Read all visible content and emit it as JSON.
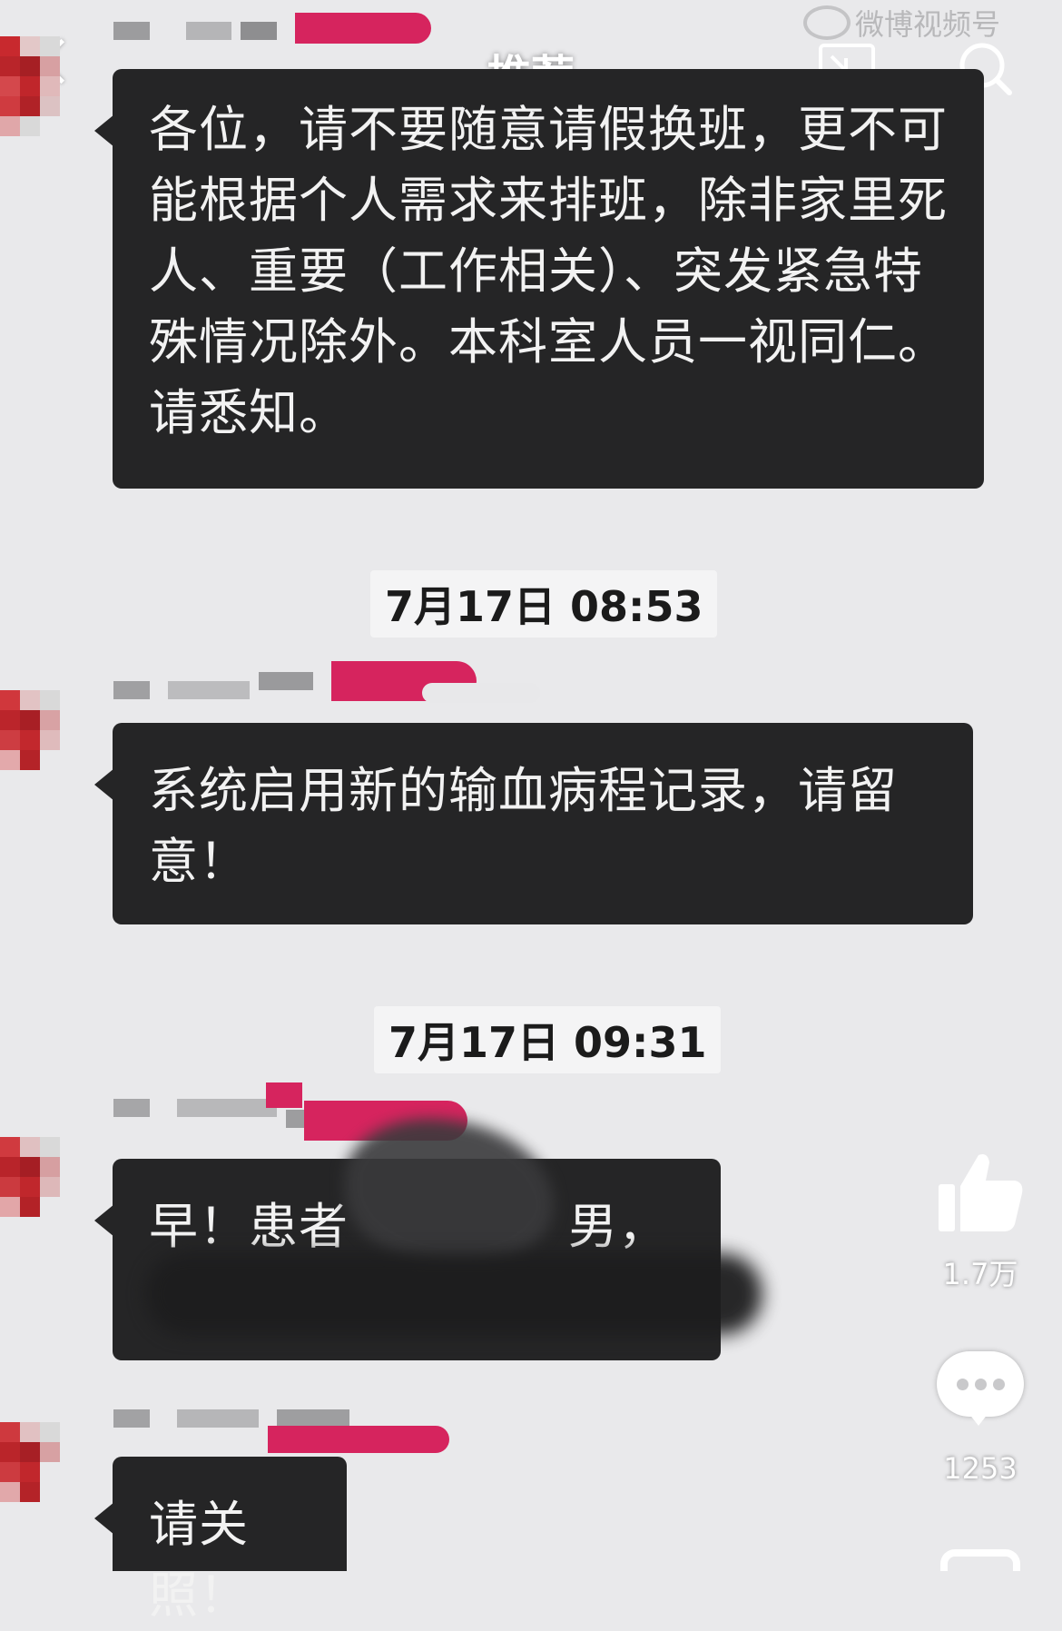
{
  "header": {
    "title": "推荐",
    "back_icon": "chevron-left-icon",
    "cast_icon": "screen-cast-icon",
    "search_icon": "search-icon",
    "watermark": "微博视频号"
  },
  "messages": [
    {
      "text": "各位，请不要随意请假换班，更不可能根据个人需求来排班，除非家里死人、重要（工作相关）、突发紧急特殊情况除外。本科室人员一视同仁。请悉知。"
    },
    {
      "text": "系统启用新的输血病程记录，请留意！"
    },
    {
      "text": "早！患者",
      "text_tail": "男，"
    },
    {
      "text": "请关照！"
    }
  ],
  "timestamps": [
    "7月17日 08:53",
    "7月17日 09:31"
  ],
  "actions": {
    "like_count": "1.7万",
    "comment_count": "1253"
  },
  "colors": {
    "background": "#e9e9eb",
    "bubble": "#252526",
    "mosaic_red": "#d6245e"
  }
}
